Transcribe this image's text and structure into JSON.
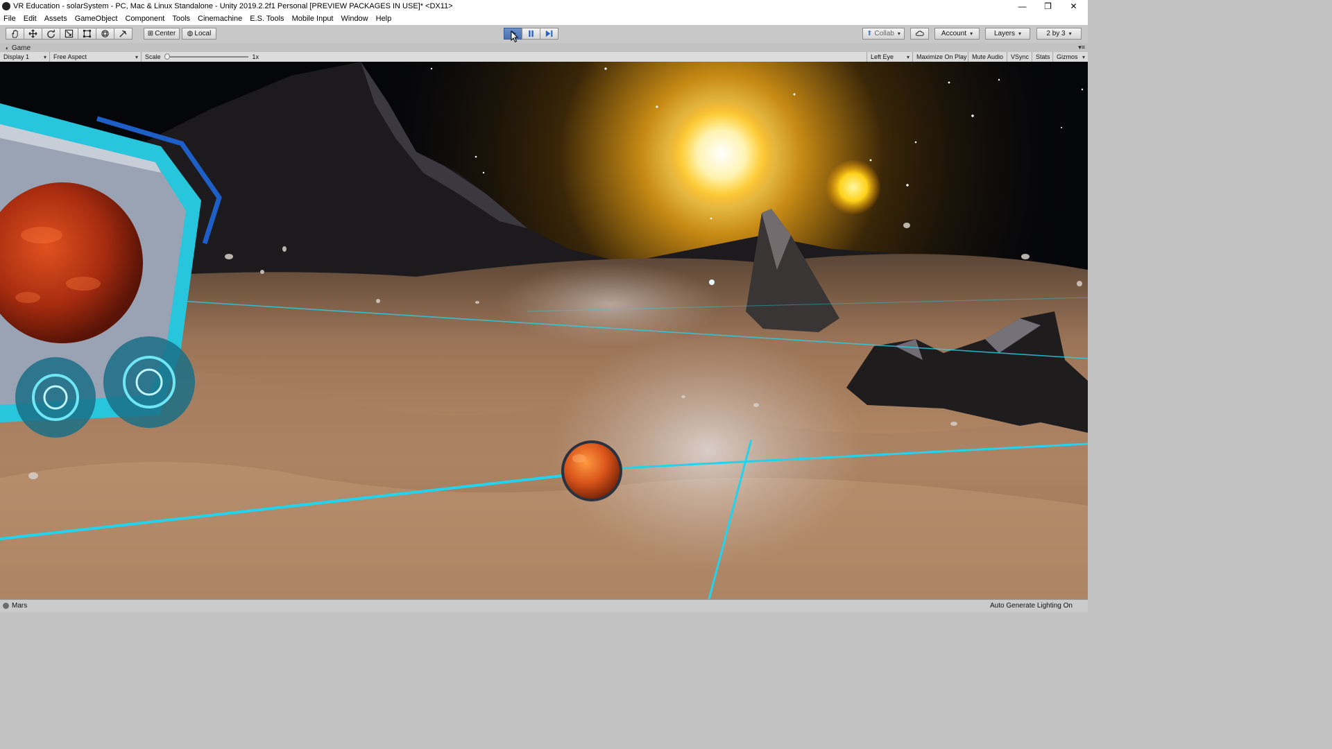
{
  "window": {
    "title": "VR Education - solarSystem - PC, Mac & Linux Standalone - Unity 2019.2.2f1 Personal [PREVIEW PACKAGES IN USE]* <DX11>",
    "controls": {
      "minimize": "—",
      "restore": "❐",
      "close": "✕"
    }
  },
  "menu": {
    "items": [
      "File",
      "Edit",
      "Assets",
      "GameObject",
      "Component",
      "Tools",
      "Cinemachine",
      "E.S. Tools",
      "Mobile Input",
      "Window",
      "Help"
    ]
  },
  "toolbar": {
    "tools": [
      "hand-tool",
      "move-tool",
      "rotate-tool",
      "scale-tool",
      "rect-tool",
      "transform-tool",
      "custom-tool"
    ],
    "pivot_label": "Center",
    "space_label": "Local",
    "play_state": "playing",
    "collab_label": "Collab",
    "account_label": "Account",
    "layers_label": "Layers",
    "layout_label": "2 by 3"
  },
  "game_view": {
    "tab_label": "Game",
    "display_label": "Display 1",
    "aspect_label": "Free Aspect",
    "scale_label": "Scale",
    "scale_value": "1x",
    "eye_label": "Left Eye",
    "maximize_label": "Maximize On Play",
    "mute_label": "Mute Audio",
    "vsync_label": "VSync",
    "stats_label": "Stats",
    "gizmos_label": "Gizmos"
  },
  "status": {
    "message": "Mars",
    "lighting": "Auto Generate Lighting On"
  },
  "colors": {
    "play_active": "#4a71b4",
    "orbit_line": "#22d3ee",
    "sand": "#a07a5a",
    "sky": "#05060a",
    "sun": "#fff6c8",
    "mars": "#c2401a"
  }
}
